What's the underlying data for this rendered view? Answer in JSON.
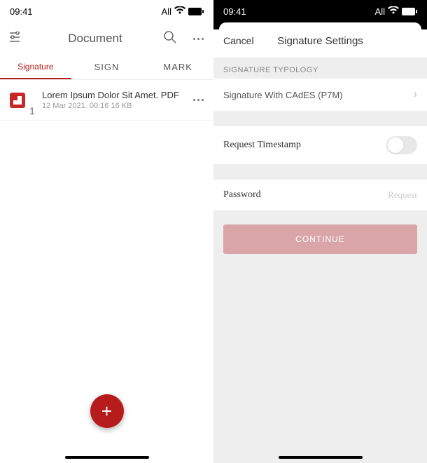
{
  "status": {
    "time": "09:41",
    "network": "All"
  },
  "left": {
    "header_title": "Document",
    "tabs": [
      {
        "label": "Signature"
      },
      {
        "label": "SIGN"
      },
      {
        "label": "MARK"
      }
    ],
    "file": {
      "name": "Lorem Ipsum Dolor Sit Amet. PDF",
      "meta": "12 Mar 2021. 00:16 16 KB",
      "number": "1"
    }
  },
  "right": {
    "cancel": "Cancel",
    "title": "Signature Settings",
    "section_typology": "SIGNATURE TYPOLOGY",
    "typology_value": "Signature With CAdES (P7M)",
    "timestamp_label": "Request Timestamp",
    "password_label": "Password",
    "password_placeholder": "Request",
    "continue": "CONTINUE"
  }
}
